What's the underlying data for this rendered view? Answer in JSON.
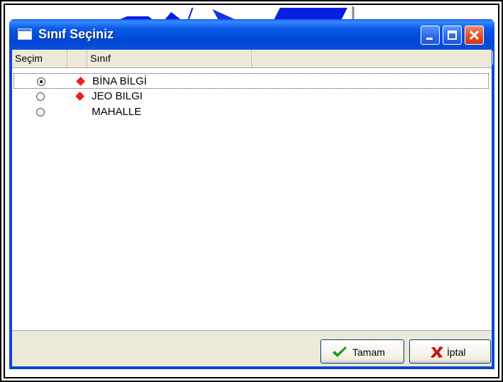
{
  "window": {
    "title": "Sınıf Seçiniz",
    "controls": [
      "minimize-icon",
      "maximize-icon",
      "close-icon"
    ]
  },
  "list": {
    "columns": [
      "Seçim",
      "",
      "Sınıf",
      ""
    ],
    "rows": [
      {
        "label": "BİNA BİLGİ",
        "selected": true,
        "marker": "red-diamond-icon",
        "focused": true
      },
      {
        "label": "JEO BILGI",
        "selected": false,
        "marker": "red-diamond-icon",
        "focused": false
      },
      {
        "label": "MAHALLE",
        "selected": false,
        "marker": "",
        "focused": false
      }
    ]
  },
  "buttons": {
    "ok": {
      "label": "Tamam",
      "icon": "checkmark-icon"
    },
    "cancel": {
      "label": "İptal",
      "icon": "x-icon"
    }
  },
  "colors": {
    "titlebar": "#0a5ae8",
    "marker": "#ee1c1c",
    "close_button": "#e04a20",
    "ok_icon": "#2a9a1a",
    "cancel_icon": "#c81414"
  }
}
